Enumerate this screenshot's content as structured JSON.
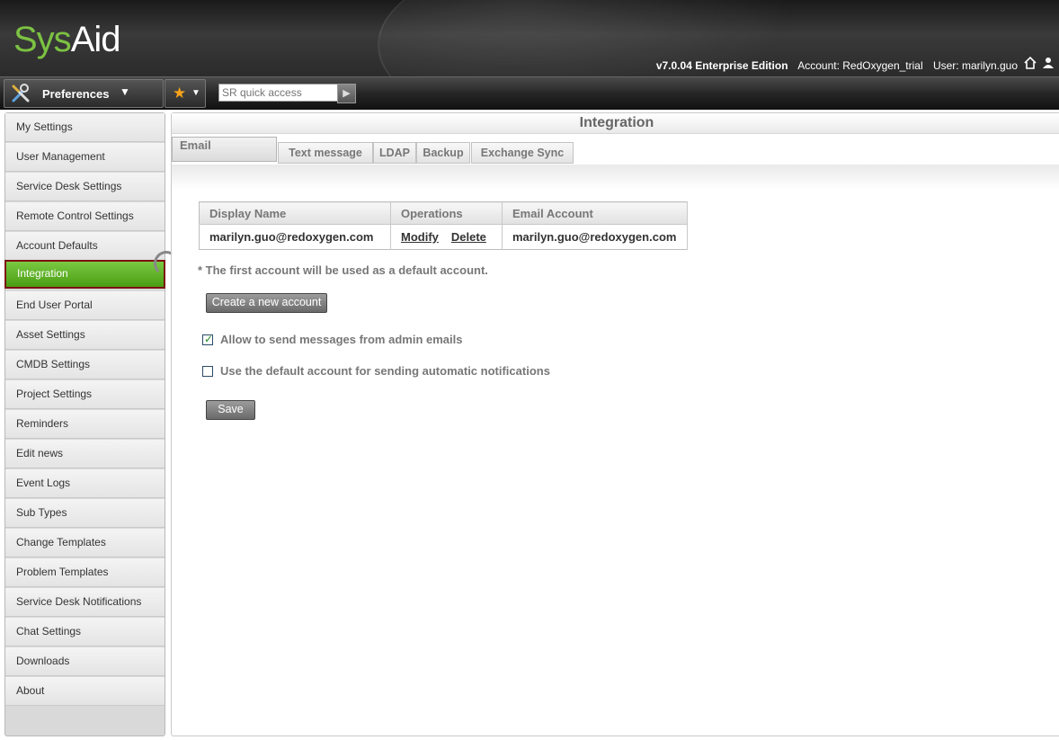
{
  "app": {
    "logo_part1": "Sys",
    "logo_part2": "Aid",
    "version": "v7.0.04 Enterprise Edition",
    "account": "Account: RedOxygen_trial",
    "user": "User: marilyn.guo"
  },
  "toolbar": {
    "preferences_label": "Preferences",
    "search_placeholder": "SR quick access"
  },
  "sidebar": {
    "items": [
      "My Settings",
      "User Management",
      "Service Desk Settings",
      "Remote Control Settings",
      "Account Defaults",
      "Integration",
      "End User Portal",
      "Asset Settings",
      "CMDB Settings",
      "Project Settings",
      "Reminders",
      "Edit news",
      "Event Logs",
      "Sub Types",
      "Change Templates",
      "Problem Templates",
      "Service Desk Notifications",
      "Chat Settings",
      "Downloads",
      "About"
    ],
    "active": "Integration"
  },
  "main": {
    "title": "Integration",
    "tabs": [
      "Email",
      "Text message",
      "LDAP",
      "Backup",
      "Exchange Sync"
    ],
    "active_tab": "Email",
    "table": {
      "headers": [
        "Display Name",
        "Operations",
        "Email Account"
      ],
      "rows": [
        {
          "display_name": "marilyn.guo@redoxygen.com",
          "op_modify": "Modify",
          "op_delete": "Delete",
          "email": "marilyn.guo@redoxygen.com"
        }
      ]
    },
    "note": "* The first account will be used as a default account.",
    "create_button": "Create a new account",
    "options": [
      {
        "label": "Allow to send messages from admin emails",
        "checked": true
      },
      {
        "label": "Use the default account for sending automatic notifications",
        "checked": false
      }
    ],
    "save_button": "Save"
  },
  "colors": {
    "brand_green": "#7cc242",
    "active_nav": "#5aad1f",
    "active_border": "#7a1010"
  }
}
